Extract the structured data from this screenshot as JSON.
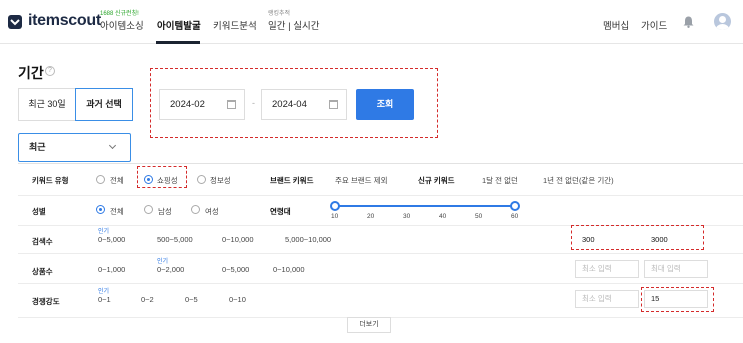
{
  "header": {
    "logo": "itemscout",
    "nav": [
      {
        "badge": "1688 신규런칭!",
        "label": "아이템소싱"
      },
      {
        "badge": "",
        "label": "아이템발굴"
      },
      {
        "badge": "",
        "label": "키워드분석"
      },
      {
        "badge": "랭킹추적",
        "label": "일간 | 실시간"
      }
    ],
    "right": {
      "membership": "멤버십",
      "guide": "가이드"
    }
  },
  "period": {
    "title": "기간",
    "tabs": [
      "최근 30일",
      "과거 선택"
    ],
    "start_date": "2024-02",
    "end_date": "2024-04",
    "separator": "-",
    "search_button": "조회"
  },
  "recent_dropdown": {
    "value": "최근"
  },
  "filters": {
    "keyword_type": {
      "label": "키워드 유형",
      "options": [
        "전체",
        "쇼핑성",
        "정보성"
      ],
      "selected": "쇼핑성"
    },
    "brand_keyword": {
      "label": "브랜드 키워드",
      "option": "주요 브랜드 제외"
    },
    "new_keyword": {
      "label": "신규 키워드",
      "options": [
        "1달 전 없던",
        "1년 전 없던(같은 기간)"
      ]
    },
    "gender": {
      "label": "성별",
      "options": [
        "전체",
        "남성",
        "여성"
      ],
      "selected": "전체"
    },
    "age": {
      "label": "연령대",
      "ticks": [
        "10",
        "20",
        "30",
        "40",
        "50",
        "60"
      ],
      "range": [
        10,
        60
      ]
    },
    "search_volume": {
      "label": "검색수",
      "popular": "인기",
      "options": [
        "0~5,000",
        "500~5,000",
        "0~10,000",
        "5,000~10,000"
      ],
      "min": "300",
      "max": "3000"
    },
    "product_count": {
      "label": "상품수",
      "popular": "인기",
      "options": [
        "0~1,000",
        "0~2,000",
        "0~5,000",
        "0~10,000"
      ],
      "min_placeholder": "최소 입력",
      "max_placeholder": "최대 입력"
    },
    "competition": {
      "label": "경쟁강도",
      "popular": "인기",
      "options": [
        "0~1",
        "0~2",
        "0~5",
        "0~10"
      ],
      "min_placeholder": "최소 입력",
      "max": "15"
    }
  },
  "more_button": "더보기",
  "colors": {
    "accent": "#2f7ae5",
    "highlight": "#d42b2b",
    "brand_green": "#2aa52a"
  },
  "icons": [
    "logo-icon",
    "help-icon",
    "calendar-icon",
    "chevron-down-icon",
    "bell-icon",
    "avatar-icon"
  ]
}
